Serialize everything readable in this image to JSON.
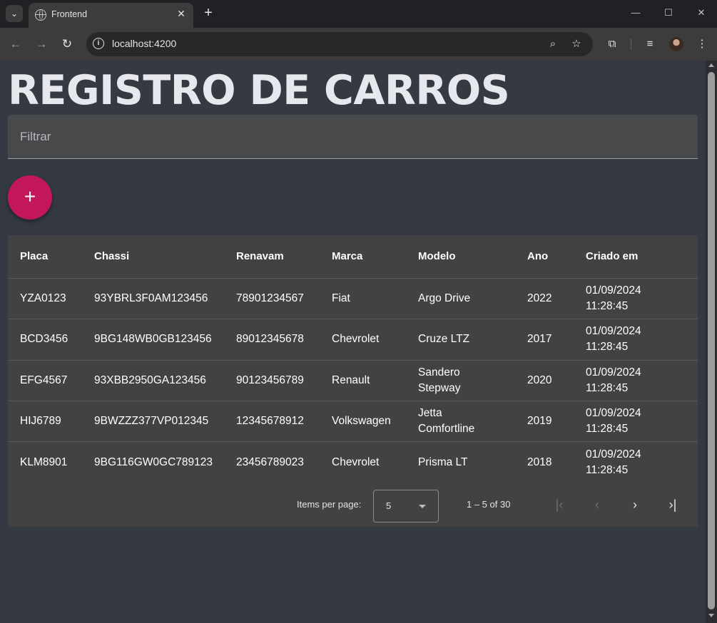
{
  "browser": {
    "tab_title": "Frontend",
    "url": "localhost:4200"
  },
  "page": {
    "title": "REGISTRO DE CARROS",
    "filter_placeholder": "Filtrar",
    "add_button_label": "+"
  },
  "table": {
    "columns": [
      "Placa",
      "Chassi",
      "Renavam",
      "Marca",
      "Modelo",
      "Ano",
      "Criado em"
    ],
    "rows": [
      {
        "placa": "YZA0123",
        "chassi": "93YBRL3F0AM123456",
        "renavam": "78901234567",
        "marca": "Fiat",
        "modelo": "Argo Drive",
        "ano": "2022",
        "criado_em": "01/09/2024 11:28:45"
      },
      {
        "placa": "BCD3456",
        "chassi": "9BG148WB0GB123456",
        "renavam": "89012345678",
        "marca": "Chevrolet",
        "modelo": "Cruze LTZ",
        "ano": "2017",
        "criado_em": "01/09/2024 11:28:45"
      },
      {
        "placa": "EFG4567",
        "chassi": "93XBB2950GA123456",
        "renavam": "90123456789",
        "marca": "Renault",
        "modelo": "Sandero Stepway",
        "ano": "2020",
        "criado_em": "01/09/2024 11:28:45"
      },
      {
        "placa": "HIJ6789",
        "chassi": "9BWZZZ377VP012345",
        "renavam": "12345678912",
        "marca": "Volkswagen",
        "modelo": "Jetta Comfortline",
        "ano": "2019",
        "criado_em": "01/09/2024 11:28:45"
      },
      {
        "placa": "KLM8901",
        "chassi": "9BG116GW0GC789123",
        "renavam": "23456789023",
        "marca": "Chevrolet",
        "modelo": "Prisma LT",
        "ano": "2018",
        "criado_em": "01/09/2024 11:28:45"
      }
    ]
  },
  "paginator": {
    "items_per_page_label": "Items per page:",
    "page_size": "5",
    "range_label": "1 – 5 of 30"
  },
  "colors": {
    "page_bg": "#353941",
    "card_bg": "#424242",
    "fab": "#c2185b"
  }
}
